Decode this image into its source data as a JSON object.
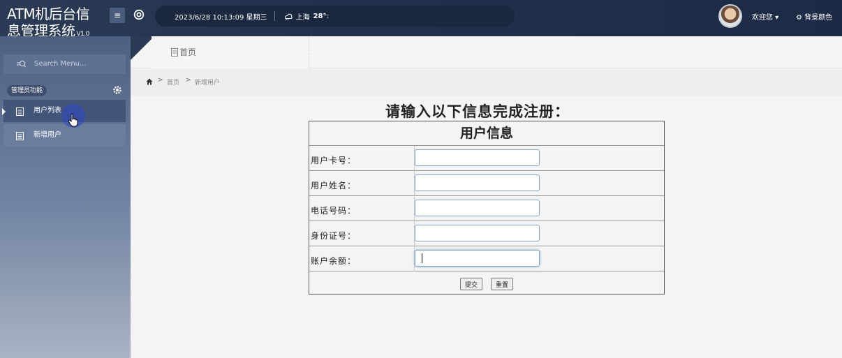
{
  "header": {
    "app_title_line1": "ATM机后台信",
    "app_title_line2": "息管理系统",
    "version": "V1.0",
    "datetime": "2023/6/28 10:13:09 星期三",
    "city": "上海",
    "temperature": "28°",
    "temp_suffix": ":",
    "welcome": "欢迎您",
    "welcome_caret": "▾",
    "bg_color": "背景颜色"
  },
  "sidebar": {
    "search_placeholder": "Search Menu...",
    "section_label": "管理员功能",
    "items": [
      {
        "label": "用户列表"
      },
      {
        "label": "新增用户"
      }
    ]
  },
  "tabs": {
    "home": "首页"
  },
  "breadcrumb": {
    "home": "首页",
    "current": "新增用户",
    "separator": ">"
  },
  "form": {
    "title": "请输入以下信息完成注册：",
    "table_title": "用户信息",
    "fields": [
      {
        "label": "用户卡号：",
        "value": ""
      },
      {
        "label": "用户姓名：",
        "value": ""
      },
      {
        "label": "电话号码：",
        "value": ""
      },
      {
        "label": "身份证号：",
        "value": ""
      },
      {
        "label": "账户余额：",
        "value": ""
      }
    ],
    "submit_label": "提交",
    "reset_label": "重置"
  },
  "icons": {
    "menu_toggle": "menu-icon",
    "settings": "gear-icon",
    "weather": "cloud-sun-icon",
    "search": "search-icon",
    "document": "document-icon",
    "home": "home-icon"
  },
  "colors": {
    "header_bg": "#22324c",
    "sidebar_active": "#43567a",
    "input_border": "#7ea7c9"
  }
}
